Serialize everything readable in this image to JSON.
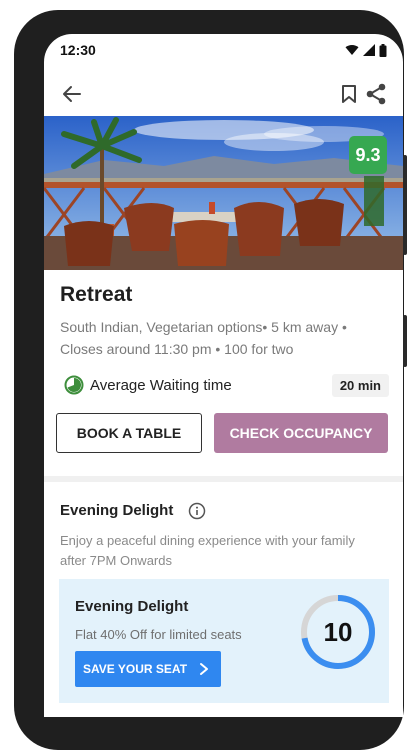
{
  "status_bar": {
    "time": "12:30"
  },
  "restaurant": {
    "rating": "9.3",
    "name": "Retreat",
    "details_line1": "South Indian, Vegetarian options• 5 km away •",
    "details_line2": "Closes around 11:30 pm • 100 for two"
  },
  "waiting": {
    "label": "Average Waiting time",
    "value": "20 min"
  },
  "actions": {
    "book_label": "BOOK A TABLE",
    "check_label": "CHECK OCCUPANCY"
  },
  "offer_section": {
    "title": "Evening Delight",
    "desc_line1": "Enjoy a peaceful dining experience with your family",
    "desc_line2": "after 7PM Onwards"
  },
  "promo_card": {
    "title": "Evening Delight",
    "subtitle": "Flat 40% Off for limited seats",
    "button_label": "SAVE YOUR SEAT",
    "seats_left": "10",
    "ring_fill_fraction": 0.72
  },
  "colors": {
    "rating_bg": "#36a851",
    "check_button": "#b07ba0",
    "save_button": "#2f87f0",
    "promo_bg": "#e3f2fb",
    "ring_active": "#3b8ef0",
    "ring_track": "#d6d6d6"
  },
  "icons": [
    "wifi-icon",
    "signal-icon",
    "battery-icon",
    "back-arrow-icon",
    "bookmark-icon",
    "share-icon",
    "clock-icon",
    "info-icon",
    "chevron-right-icon"
  ]
}
